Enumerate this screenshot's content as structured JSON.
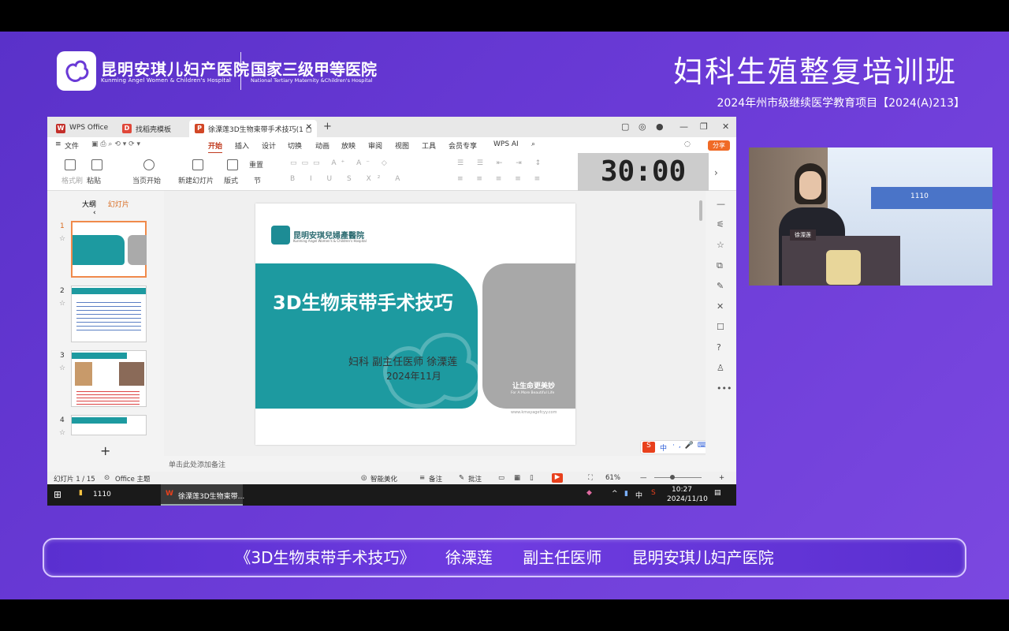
{
  "header": {
    "hospital_cn": "昆明安琪儿妇产医院",
    "hospital_en": "Kunming Angel Women & Children's Hospital",
    "national_cn": "国家三级甲等医院",
    "national_en": "National Tertiary Maternity &Children's Hospital",
    "course_title": "妇科生殖整复培训班",
    "course_subtitle": "2024年州市级继续医学教育项目【2024(A)213】"
  },
  "wps": {
    "tabs": [
      {
        "label": "WPS Office",
        "icon": "W"
      },
      {
        "label": "找稻壳模板",
        "icon": "D"
      },
      {
        "label": "徐溧莲3D生物束带手术技巧(1 ◻",
        "icon": "P"
      }
    ],
    "new_tab": "+",
    "menu": {
      "file": "文件",
      "items": [
        "开始",
        "插入",
        "设计",
        "切换",
        "动画",
        "放映",
        "审阅",
        "视图",
        "工具",
        "会员专享"
      ],
      "wps_ai": "WPS AI",
      "share": "分享"
    },
    "ribbon": {
      "format_painter": "格式刷",
      "paste": "粘贴",
      "play_from_start": "当页开始",
      "new_slide": "新建幻灯片",
      "layout": "版式",
      "section": "节",
      "reset": "重置"
    },
    "timer": "30:00",
    "left_pane": {
      "outline_tab": "大纲",
      "slides_tab": "幻灯片",
      "slide_numbers": [
        "1",
        "2",
        "3",
        "4"
      ],
      "add": "+"
    },
    "slide": {
      "logo_cn": "昆明安琪兒婦產醫院",
      "logo_en": "Kunming Angel Women's & Children's Hospital",
      "title": "3D生物束带手术技巧",
      "author": "妇科   副主任医师  徐溧莲",
      "date": "2024年11月",
      "slogan": "让生命更美妙",
      "slogan_en": "For A More Beautiful Life",
      "url": "www.kmayagefcyy.com"
    },
    "notes_placeholder": "单击此处添加备注",
    "status": {
      "slide_count": "幻灯片 1 / 15",
      "theme": "Office 主题",
      "smart_beautify": "智能美化",
      "notes": "备注",
      "comments": "批注",
      "zoom": "61%"
    },
    "taskbar": {
      "folder": "1110",
      "active_app": "徐溧莲3D生物束带...",
      "ime": "中",
      "time": "10:27",
      "date": "2024/11/10"
    }
  },
  "camera": {
    "screen_text": "1110",
    "podium_name": "徐溧莲"
  },
  "lower_third": {
    "title": "《3D生物束带手术技巧》",
    "speaker": "徐溧莲",
    "role": "副主任医师",
    "org": "昆明安琪儿妇产医院"
  },
  "colors": {
    "background": "#6a3ad6",
    "slide_teal": "#1d9aa0",
    "wps_accent": "#c03a1e",
    "share_orange": "#f06a26"
  }
}
